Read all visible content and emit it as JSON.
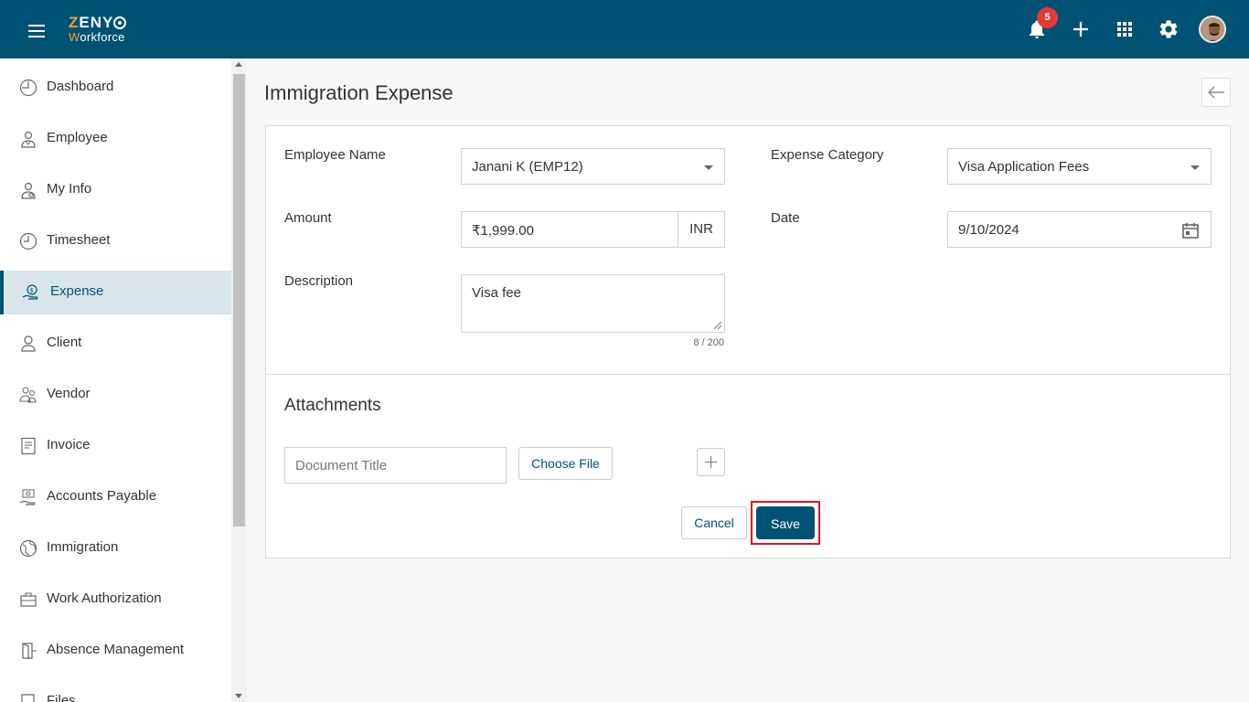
{
  "header": {
    "logo_main": "ZENY",
    "logo_sub": "Workforce",
    "notification_count": "5"
  },
  "sidebar": {
    "items": [
      {
        "label": "Dashboard",
        "icon": "clock-icon"
      },
      {
        "label": "Employee",
        "icon": "employee-icon"
      },
      {
        "label": "My Info",
        "icon": "person-badge-icon"
      },
      {
        "label": "Timesheet",
        "icon": "clock-icon"
      },
      {
        "label": "Expense",
        "icon": "expense-icon"
      },
      {
        "label": "Client",
        "icon": "user-icon"
      },
      {
        "label": "Vendor",
        "icon": "vendor-icon"
      },
      {
        "label": "Invoice",
        "icon": "invoice-icon"
      },
      {
        "label": "Accounts Payable",
        "icon": "accounts-payable-icon"
      },
      {
        "label": "Immigration",
        "icon": "globe-icon"
      },
      {
        "label": "Work Authorization",
        "icon": "briefcase-icon"
      },
      {
        "label": "Absence Management",
        "icon": "door-exit-icon"
      },
      {
        "label": "Files",
        "icon": "file-icon"
      }
    ],
    "active_index": 4
  },
  "page": {
    "title": "Immigration Expense"
  },
  "form": {
    "employee_name_label": "Employee Name",
    "employee_name_value": "Janani K (EMP12)",
    "expense_category_label": "Expense Category",
    "expense_category_value": "Visa Application Fees",
    "amount_label": "Amount",
    "amount_value": "₹1,999.00",
    "currency": "INR",
    "date_label": "Date",
    "date_value": "9/10/2024",
    "description_label": "Description",
    "description_value": "Visa fee",
    "description_counter": "8 / 200"
  },
  "attachments": {
    "title": "Attachments",
    "doc_title_placeholder": "Document Title",
    "choose_file_label": "Choose File"
  },
  "actions": {
    "cancel_label": "Cancel",
    "save_label": "Save"
  },
  "colors": {
    "brand": "#005274",
    "accent": "#f39a3b",
    "badge": "#e53935",
    "highlight": "#e0141e"
  }
}
